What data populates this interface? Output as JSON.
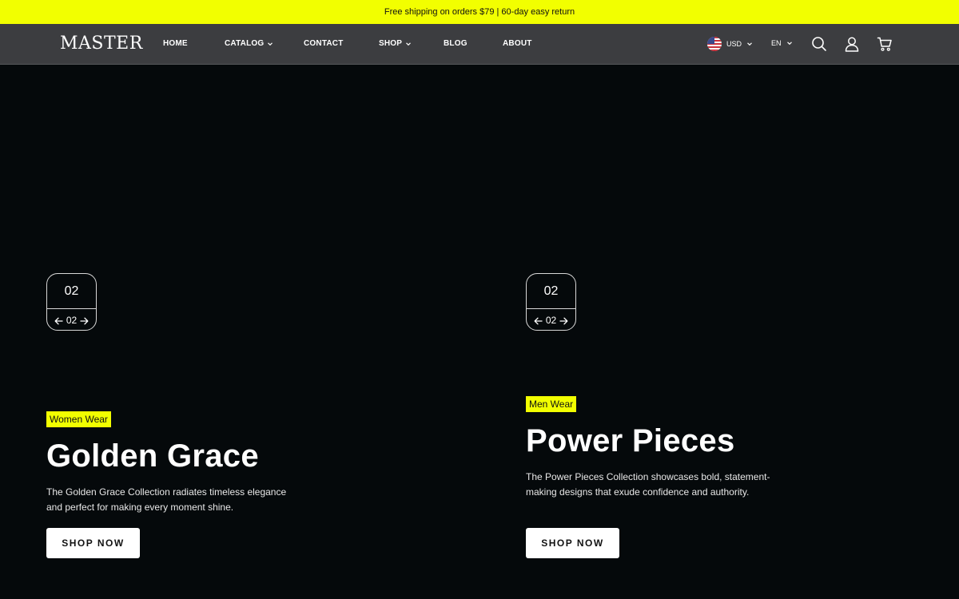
{
  "announcement": "Free shipping on orders $79 | 60-day easy return",
  "header": {
    "logo": "MASTER",
    "nav": [
      {
        "label": "HOME"
      },
      {
        "label": "CATALOG"
      },
      {
        "label": "CONTACT"
      },
      {
        "label": "SHOP"
      },
      {
        "label": "BLOG"
      },
      {
        "label": "ABOUT"
      }
    ],
    "currency": "USD",
    "language": "EN",
    "icons": [
      "us-flag-icon",
      "search-icon",
      "account-icon",
      "cart-icon"
    ]
  },
  "slides": [
    {
      "counter_big": "02",
      "counter_small": "02",
      "tag": "Women Wear",
      "title": "Golden Grace",
      "description": "The Golden Grace Collection radiates timeless elegance and perfect for making every moment shine.",
      "button": "SHOP NOW"
    },
    {
      "counter_big": "02",
      "counter_small": "02",
      "tag": "Men Wear",
      "title": "Power Pieces",
      "description": "The Power Pieces Collection showcases bold, statement-making designs that exude confidence and authority.",
      "button": "SHOP NOW"
    }
  ],
  "colors": {
    "accent": "#f2ff00",
    "header_bg": "#3c3d40",
    "page_bg": "#05090b"
  }
}
